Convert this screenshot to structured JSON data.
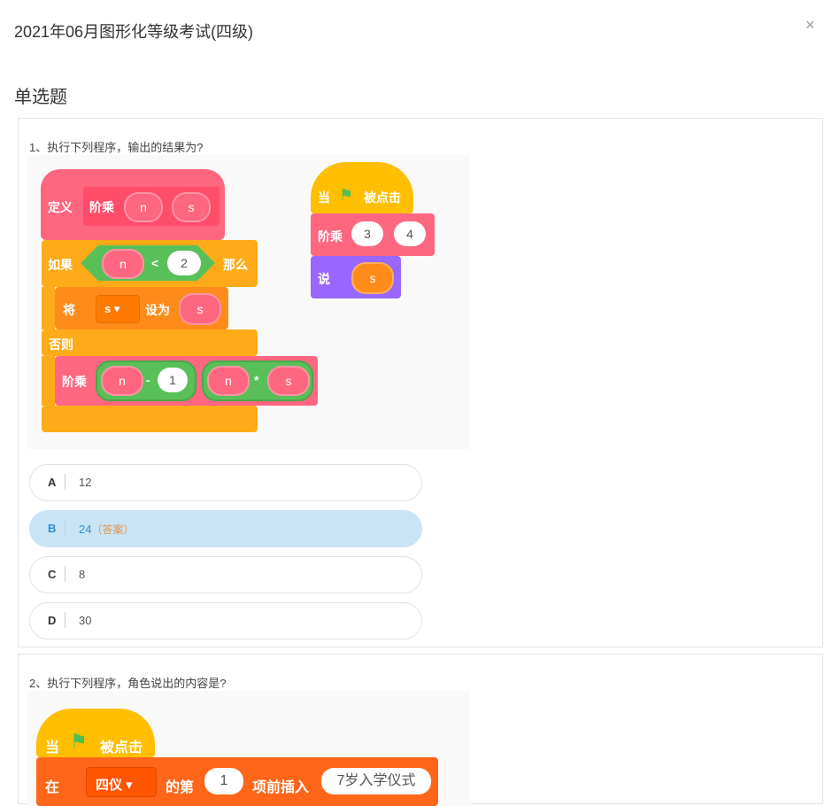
{
  "exam": {
    "title": "2021年06月图形化等级考试(四级)",
    "close_glyph": "×"
  },
  "section": {
    "title": "单选题"
  },
  "q1": {
    "text": "1、执行下列程序，输出的结果为?",
    "blocks": {
      "define": "定义",
      "factorial": "阶乘",
      "n": "n",
      "s": "s",
      "if": "如果",
      "lt": "<",
      "two": "2",
      "then": "那么",
      "set": "将",
      "set_var": "s ▾",
      "set_to": "设为",
      "else": "否则",
      "minus": "-",
      "one": "1",
      "times": "*",
      "when": "当",
      "clicked": "被点击",
      "three": "3",
      "four": "4",
      "say": "说"
    },
    "options": [
      {
        "letter": "A",
        "value": "12",
        "answer": ""
      },
      {
        "letter": "B",
        "value": "24",
        "answer": "（答案）"
      },
      {
        "letter": "C",
        "value": "8",
        "answer": ""
      },
      {
        "letter": "D",
        "value": "30",
        "answer": ""
      }
    ]
  },
  "q2": {
    "text": "2、执行下列程序，角色说出的内容是?",
    "blocks": {
      "when": "当",
      "clicked": "被点击",
      "in": "在",
      "list": "四仪 ▾",
      "of_nth": "的第",
      "one": "1",
      "insert": "项前插入",
      "item": "7岁入学仪式"
    }
  },
  "colors": {
    "custom": "#ff6680",
    "control": "#ffab19",
    "operator": "#59c059",
    "variable": "#ff8c1a",
    "event": "#ffbf00",
    "looks": "#9966ff",
    "list": "#ff661a",
    "selected": "#c8e4f5"
  }
}
